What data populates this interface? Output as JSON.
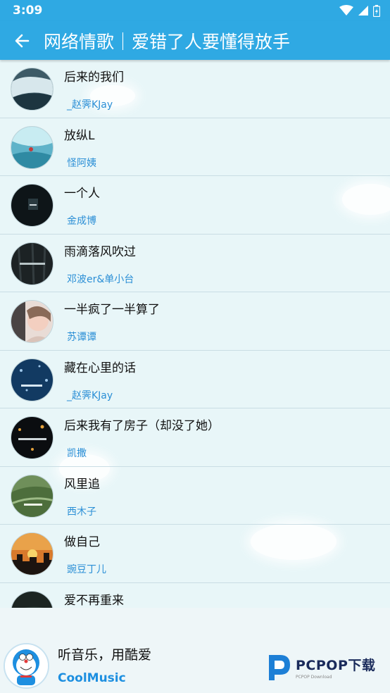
{
  "status_bar": {
    "time": "3:09"
  },
  "header": {
    "back_icon": "arrow-left-icon",
    "title": "网络情歌｜爱错了人要懂得放手"
  },
  "songs": [
    {
      "title": "后来的我们",
      "artist": "_赵霁KJay"
    },
    {
      "title": "放纵L",
      "artist": "怪阿姨"
    },
    {
      "title": "一个人",
      "artist": "金成博"
    },
    {
      "title": "雨滴落风吹过",
      "artist": "邓波er&单小台"
    },
    {
      "title": "一半疯了一半算了",
      "artist": "苏谭谭"
    },
    {
      "title": "藏在心里的话",
      "artist": "_赵霁KJay"
    },
    {
      "title": "后来我有了房子（却没了她）",
      "artist": "凯撒"
    },
    {
      "title": "风里追",
      "artist": "西木子"
    },
    {
      "title": "做自己",
      "artist": "豌豆丁儿"
    },
    {
      "title": "爱不再重来",
      "artist": ""
    }
  ],
  "footer": {
    "slogan": "听音乐，用酷爱",
    "brand": "CoolMusic"
  },
  "watermark": {
    "brand": "PCPOP下载",
    "sub": "PCPOP Download"
  },
  "colors": {
    "primary": "#2fa9e3",
    "artist_text": "#2b8fd6",
    "background": "#e8f6f8"
  }
}
